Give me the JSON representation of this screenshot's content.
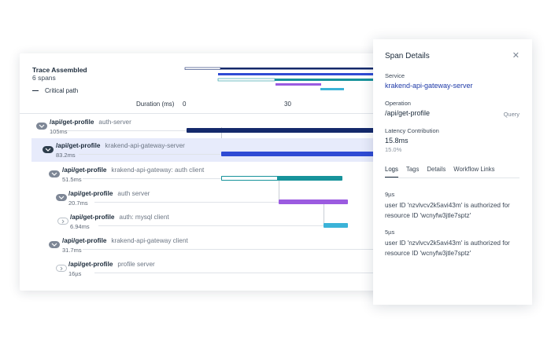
{
  "trace": {
    "title": "Trace Assembled",
    "span_count": "6 spans",
    "critical_path_label": "Critical path",
    "duration_header": "Duration (ms)",
    "ticks": [
      "0",
      "30"
    ]
  },
  "spans": [
    {
      "name": "/api/get-profile",
      "service": "auth-server",
      "duration": "105ms"
    },
    {
      "name": "/api/get-profile",
      "service": "krakend-api-gateway-server",
      "duration": "83.2ms"
    },
    {
      "name": "/api/get-profile",
      "service": "krakend-api-gateway: auth client",
      "duration": "51.5ms"
    },
    {
      "name": "/api/get-profile",
      "service": "auth server",
      "duration": "20.7ms"
    },
    {
      "name": "/api/get-profile",
      "service": "auth: mysql client",
      "duration": "6.94ms"
    },
    {
      "name": "/api/get-profile",
      "service": "krakend-api-gateway client",
      "duration": "31.7ms"
    },
    {
      "name": "/api/get-profile",
      "service": "profile server",
      "duration": "16µs"
    }
  ],
  "details": {
    "title": "Span Details",
    "close_icon": "close-icon",
    "service_label": "Service",
    "service_value": "krakend-api-gateway-server",
    "operation_label": "Operation",
    "operation_value": "/api/get-profile",
    "operation_type": "Query",
    "latency_label": "Latency Contribution",
    "latency_value": "15.8ms",
    "latency_percent": "15.0%",
    "tabs": [
      "Logs",
      "Tags",
      "Details",
      "Workflow Links"
    ],
    "active_tab": "Logs",
    "logs": [
      {
        "time": "9µs",
        "message": "user ID 'nzvlvcv2k5avi43m' is authorized for resource ID 'wcnyfw3jtle7sptz'"
      },
      {
        "time": "5µs",
        "message": "user ID 'nzvlvcv2k5avi43m' is authorized for resource ID 'wcnyfw3jtle7sptz'"
      }
    ]
  },
  "colors": {
    "navy": "#14296b",
    "blue": "#2f4bd4",
    "teal": "#17939b",
    "purple": "#9b5be0",
    "cyan": "#3bb3d8",
    "selected_row": "#e7ebfb"
  }
}
